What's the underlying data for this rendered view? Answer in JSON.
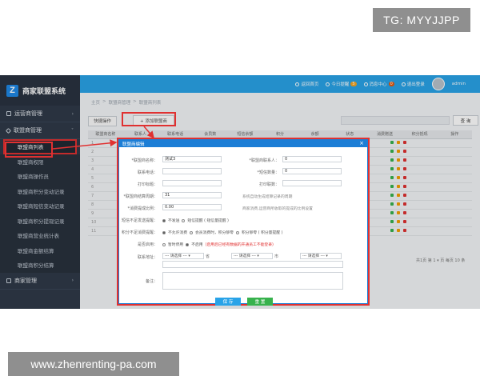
{
  "watermarks": {
    "top": "TG: MYYJJPP",
    "bottom": "www.zhenrenting-pa.com"
  },
  "brand": {
    "logo_letter": "Z",
    "name": "商家联盟系统"
  },
  "sidebar": {
    "groups": [
      {
        "label": "运营商管理",
        "icon": "monitor-icon",
        "chevron": "›"
      },
      {
        "label": "联盟商管理",
        "icon": "diamond-icon",
        "chevron": "˅"
      }
    ],
    "items": [
      {
        "label": "联盟商列表",
        "active": true
      },
      {
        "label": "联盟商权限"
      },
      {
        "label": "联盟商操作员"
      },
      {
        "label": "联盟商积分变动记录"
      },
      {
        "label": "联盟商短信变动记录"
      },
      {
        "label": "联盟商积分提现记录"
      },
      {
        "label": "联盟商营业统计表"
      },
      {
        "label": "联盟商金额结算"
      },
      {
        "label": "联盟商积分结算"
      }
    ],
    "bottom_group": {
      "label": "商家管理",
      "chevron": "›"
    }
  },
  "topbar": {
    "items": [
      {
        "label": "返回首页"
      },
      {
        "label": "今日提醒",
        "badge": "5"
      },
      {
        "label": "消息中心",
        "badge": "0"
      },
      {
        "label": "退出登录"
      }
    ],
    "user": "admin"
  },
  "breadcrumb": [
    "主页",
    ">",
    "联盟商管理",
    ">",
    "联盟商列表"
  ],
  "toolbar": {
    "filter_label": "快捷操作",
    "add_label": "+ 添加联盟商",
    "search_label": "查 询"
  },
  "grid": {
    "headers": [
      "联盟商名称",
      "联系人",
      "联系电话",
      "会员数",
      "短信余额",
      "积分",
      "余额",
      "状态",
      "消费赠送",
      "积分抵现",
      "操作"
    ],
    "rows": [
      "1",
      "2",
      "3",
      "4",
      "5",
      "6",
      "7",
      "8",
      "9",
      "10",
      "11"
    ],
    "pager": "共1页  第 1 ▾ 页  每页 10 条"
  },
  "dialog": {
    "title": "联盟商编辑",
    "close": "×",
    "fields": {
      "name_label": "*联盟商名称：",
      "name_value": "测试3",
      "contact_label": "*联盟商联系人：",
      "contact_value": "0",
      "phone_label": "联系电话：",
      "phone_value": "",
      "sms_label": "*短信数量：",
      "sms_value": "0",
      "print_title_label": "打印标题：",
      "print_title_value": "",
      "print_copies_label": "打印联数：",
      "print_copies_value": "",
      "cycle_label": "*联盟商结算周期：",
      "cycle_value": "31",
      "cycle_note": "系统自动生成结算记录的周期",
      "ratio_label": "*消费提成比例：",
      "ratio_value": "0.00",
      "ratio_note": "商家消费,运营商所收取的提成的比例设置",
      "sms_send_label": "短信不足发送提醒：",
      "sms_send_options": [
        "不发送",
        "短信提醒 ( 短信量提醒 )"
      ],
      "points_label": "积分不足消费提醒：",
      "points_options": [
        "不允许消费",
        "会员消费时，积分够零",
        "积分够零 ( 积分量提醒 )"
      ],
      "enabled_label": "是否启用：",
      "enabled_options": [
        "暂时停用",
        "不启用"
      ],
      "enabled_note": "(启用后已经有数据的开通员工不能登录)",
      "address_label": "联系地址：",
      "province": "--- 请选择 ---",
      "province_unit": "省",
      "city": "--- 请选择 ---",
      "city_unit": "市",
      "district": "--- 请选择 ---",
      "remark_label": "备注：",
      "save": "保 存",
      "reset": "重 置"
    }
  }
}
